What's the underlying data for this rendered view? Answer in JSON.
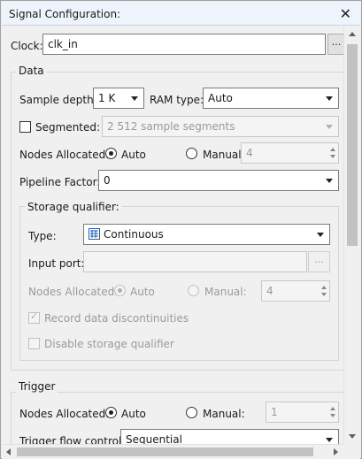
{
  "window": {
    "title": "Signal Configuration:"
  },
  "clock": {
    "label": "Clock:",
    "value": "clk_in",
    "browse_label": "..."
  },
  "data_group": {
    "title": "Data",
    "sample_depth_label": "Sample depth:",
    "sample_depth_value": "1 K",
    "ram_type_label": "RAM type:",
    "ram_type_value": "Auto",
    "segmented_label": "Segmented:",
    "segmented_checked": false,
    "segments_value": "2  512 sample segments",
    "nodes_allocated_label": "Nodes Allocated:",
    "auto_label": "Auto",
    "manual_label": "Manual:",
    "manual_value": "4",
    "pipeline_factor_label": "Pipeline Factor:",
    "pipeline_factor_value": "0"
  },
  "storage_qualifier": {
    "title": "Storage qualifier:",
    "type_label": "Type:",
    "type_icon": "continuous-waveform-icon",
    "type_value": "Continuous",
    "input_port_label": "Input port:",
    "input_port_value": "",
    "browse_label": "...",
    "nodes_allocated_label": "Nodes Allocated:",
    "auto_label": "Auto",
    "manual_label": "Manual:",
    "manual_value": "4",
    "record_label": "Record data discontinuities",
    "record_checked": true,
    "disable_label": "Disable storage qualifier",
    "disable_checked": false
  },
  "trigger_group": {
    "title": "Trigger",
    "nodes_allocated_label": "Nodes Allocated:",
    "auto_label": "Auto",
    "manual_label": "Manual:",
    "manual_value": "1",
    "flow_control_label": "Trigger flow control:",
    "flow_control_value": "Sequential"
  },
  "colors": {
    "accent": "#1e5fb4",
    "titlebar_bg": "#eef4fb",
    "panel_bg": "#f0f0f0"
  }
}
